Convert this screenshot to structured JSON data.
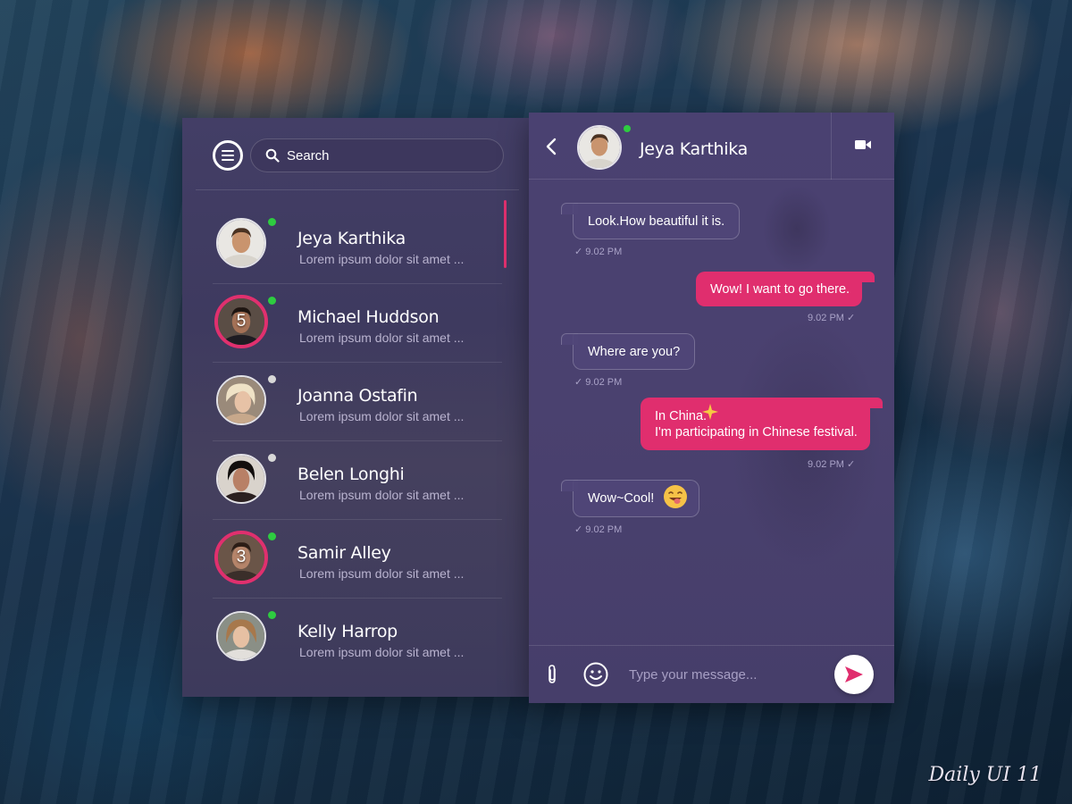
{
  "search": {
    "placeholder": "Search"
  },
  "contacts": [
    {
      "name": "Jeya Karthika",
      "preview": "Lorem ipsum dolor sit amet ...",
      "status": "online",
      "unread": "",
      "active": true,
      "skin": "#c9946e",
      "hair": "#4a3222",
      "shirt": "#d8d4cc"
    },
    {
      "name": "Michael Huddson",
      "preview": "Lorem ipsum dolor sit amet ...",
      "status": "online",
      "unread": "5",
      "active": false,
      "skin": "#a47156",
      "hair": "#1e1511",
      "shirt": "#1e1c22"
    },
    {
      "name": "Joanna Ostafin",
      "preview": "Lorem ipsum dolor sit amet ...",
      "status": "offline",
      "unread": "",
      "active": false,
      "skin": "#e7c2a6",
      "hair": "#efe2c6",
      "shirt": "#c7a88b"
    },
    {
      "name": "Belen Longhi",
      "preview": "Lorem ipsum dolor sit amet ...",
      "status": "offline",
      "unread": "",
      "active": false,
      "skin": "#b88066",
      "hair": "#120e0d",
      "shirt": "#2b2020"
    },
    {
      "name": "Samir Alley",
      "preview": "Lorem ipsum dolor sit amet ...",
      "status": "online",
      "unread": "3",
      "active": false,
      "skin": "#b5846a",
      "hair": "#2c1d16",
      "shirt": "#3a2e2a"
    },
    {
      "name": "Kelly Harrop",
      "preview": "Lorem ipsum dolor sit amet ...",
      "status": "online",
      "unread": "",
      "active": false,
      "skin": "#e6c0a3",
      "hair": "#a7784c",
      "shirt": "#e2dfdb"
    }
  ],
  "chat": {
    "name": "Jeya Karthika",
    "status": "online",
    "messages": [
      {
        "from": "them",
        "text": "Look.How beautiful it is.",
        "time": "9.02 PM"
      },
      {
        "from": "me",
        "text": "Wow! I want to go there.",
        "time": "9.02 PM"
      },
      {
        "from": "them",
        "text": "Where are you?",
        "time": "9.02 PM"
      },
      {
        "from": "me",
        "line1": "In China.",
        "line2": "I'm participating in Chinese festival.",
        "time": "9.02 PM"
      },
      {
        "from": "them",
        "text": "Wow~Cool!",
        "time": "9.02 PM"
      }
    ]
  },
  "composer": {
    "placeholder": "Type your message..."
  },
  "icons": {
    "menu": "menu-icon",
    "search": "search-icon",
    "back": "chevron-left-icon",
    "video": "video-camera-icon",
    "attach": "paperclip-icon",
    "emoji": "smiley-icon",
    "send": "send-icon"
  },
  "colors": {
    "accent": "#e02e6e",
    "online": "#2ecc40",
    "panel": "#453f6b"
  },
  "watermark": "Daily UI 11"
}
